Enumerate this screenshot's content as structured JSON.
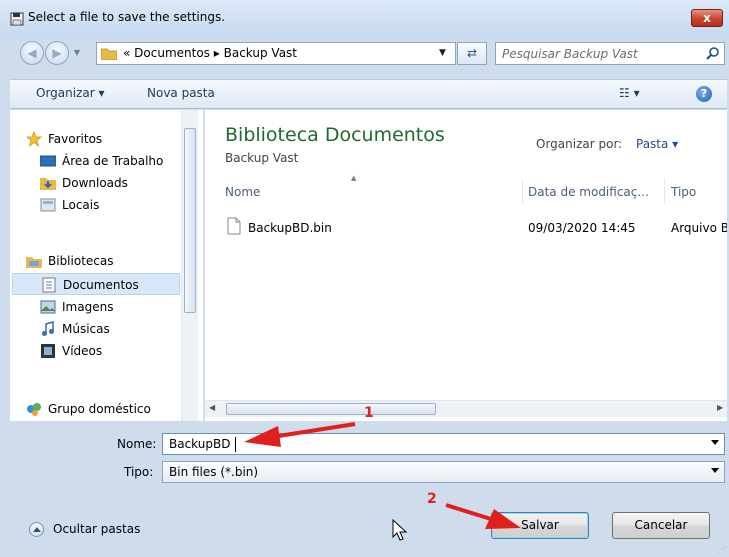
{
  "window": {
    "title": "Select a file to save the settings.",
    "close_label": "x"
  },
  "address": {
    "breadcrumb_prefix": "«",
    "crumbs": [
      "Documentos",
      "Backup Vast"
    ],
    "separator": "▸",
    "search_placeholder": "Pesquisar Backup Vast"
  },
  "toolbar": {
    "organize_label": "Organizar ▾",
    "new_folder_label": "Nova pasta",
    "view_label": "☷ ▾",
    "help_label": "?"
  },
  "nav": {
    "favorites": "Favoritos",
    "desktop": "Área de Trabalho",
    "downloads": "Downloads",
    "places": "Locais",
    "libraries": "Bibliotecas",
    "documents": "Documentos",
    "images": "Imagens",
    "music": "Músicas",
    "videos": "Vídeos",
    "homegroup": "Grupo doméstico"
  },
  "content": {
    "library_title": "Biblioteca Documentos",
    "library_subtitle": "Backup Vast",
    "arrange_label": "Organizar por:",
    "arrange_value": "Pasta ▾",
    "columns": [
      "Nome",
      "Data de modificaç...",
      "Tipo"
    ],
    "files": [
      {
        "name": "BackupBD.bin",
        "modified": "09/03/2020 14:45",
        "type": "Arquivo B"
      }
    ]
  },
  "form": {
    "name_label": "Nome:",
    "name_value": "BackupBD",
    "type_label": "Tipo:",
    "type_value": "Bin files (*.bin)"
  },
  "footer": {
    "hide_folders_label": "Ocultar pastas",
    "save_label": "Salvar",
    "cancel_label": "Cancelar"
  },
  "annotations": {
    "step1": "1",
    "step2": "2",
    "color": "#e0201b"
  },
  "colors": {
    "library_title": "#1e6a2f",
    "selection": "#d9e8f8"
  }
}
